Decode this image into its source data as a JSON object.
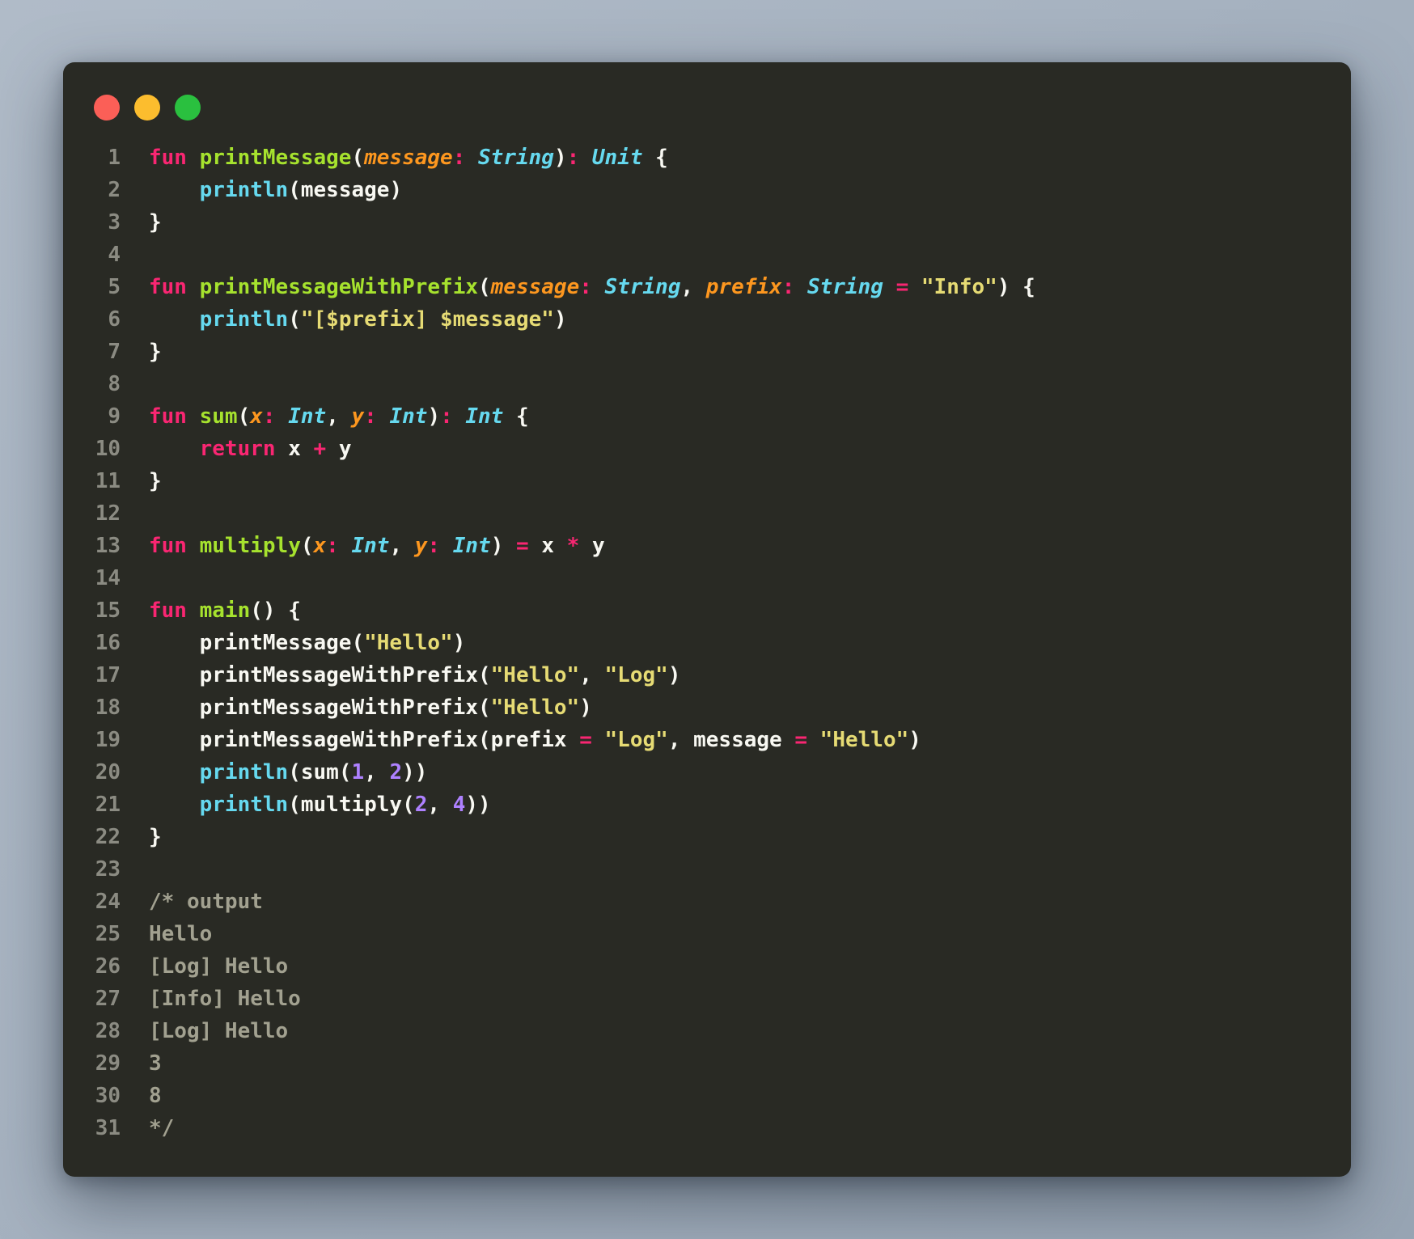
{
  "page": {
    "background_start": "#b0bbc8",
    "background_end": "#98a5b4"
  },
  "window": {
    "background": "#292a24",
    "title_bar": {
      "traffic_lights": [
        {
          "name": "close",
          "color": "#fb5f57"
        },
        {
          "name": "minimize",
          "color": "#fcbd2e"
        },
        {
          "name": "maximize",
          "color": "#2ac03f"
        }
      ]
    }
  },
  "editor": {
    "language": "kotlin",
    "gutter_color": "#8b8b82",
    "italic_token_types": [
      "param",
      "type"
    ],
    "token_colors": {
      "keyword": "#f92672",
      "function": "#a6e22e",
      "param": "#fd971f",
      "type": "#66d9ef",
      "builtin": "#66d9ef",
      "operator": "#f92672",
      "string": "#e6db74",
      "number": "#ae81ff",
      "plain": "#f8f8f2",
      "comment": "#a2a190"
    },
    "lines": [
      [
        [
          "fun",
          "keyword"
        ],
        [
          " ",
          "plain"
        ],
        [
          "printMessage",
          "function"
        ],
        [
          "(",
          "plain"
        ],
        [
          "message",
          "param"
        ],
        [
          ":",
          "operator"
        ],
        [
          " ",
          "plain"
        ],
        [
          "String",
          "type"
        ],
        [
          ")",
          "plain"
        ],
        [
          ":",
          "operator"
        ],
        [
          " ",
          "plain"
        ],
        [
          "Unit",
          "type"
        ],
        [
          " {",
          "plain"
        ]
      ],
      [
        [
          "    ",
          "plain"
        ],
        [
          "println",
          "builtin"
        ],
        [
          "(",
          "plain"
        ],
        [
          "message",
          "plain"
        ],
        [
          ")",
          "plain"
        ]
      ],
      [
        [
          "}",
          "plain"
        ]
      ],
      [],
      [
        [
          "fun",
          "keyword"
        ],
        [
          " ",
          "plain"
        ],
        [
          "printMessageWithPrefix",
          "function"
        ],
        [
          "(",
          "plain"
        ],
        [
          "message",
          "param"
        ],
        [
          ":",
          "operator"
        ],
        [
          " ",
          "plain"
        ],
        [
          "String",
          "type"
        ],
        [
          ", ",
          "plain"
        ],
        [
          "prefix",
          "param"
        ],
        [
          ":",
          "operator"
        ],
        [
          " ",
          "plain"
        ],
        [
          "String",
          "type"
        ],
        [
          " ",
          "plain"
        ],
        [
          "=",
          "operator"
        ],
        [
          " ",
          "plain"
        ],
        [
          "\"Info\"",
          "string"
        ],
        [
          ") {",
          "plain"
        ]
      ],
      [
        [
          "    ",
          "plain"
        ],
        [
          "println",
          "builtin"
        ],
        [
          "(",
          "plain"
        ],
        [
          "\"[$prefix] $message\"",
          "string"
        ],
        [
          ")",
          "plain"
        ]
      ],
      [
        [
          "}",
          "plain"
        ]
      ],
      [],
      [
        [
          "fun",
          "keyword"
        ],
        [
          " ",
          "plain"
        ],
        [
          "sum",
          "function"
        ],
        [
          "(",
          "plain"
        ],
        [
          "x",
          "param"
        ],
        [
          ":",
          "operator"
        ],
        [
          " ",
          "plain"
        ],
        [
          "Int",
          "type"
        ],
        [
          ", ",
          "plain"
        ],
        [
          "y",
          "param"
        ],
        [
          ":",
          "operator"
        ],
        [
          " ",
          "plain"
        ],
        [
          "Int",
          "type"
        ],
        [
          ")",
          "plain"
        ],
        [
          ":",
          "operator"
        ],
        [
          " ",
          "plain"
        ],
        [
          "Int",
          "type"
        ],
        [
          " {",
          "plain"
        ]
      ],
      [
        [
          "    ",
          "plain"
        ],
        [
          "return",
          "keyword"
        ],
        [
          " x ",
          "plain"
        ],
        [
          "+",
          "operator"
        ],
        [
          " y",
          "plain"
        ]
      ],
      [
        [
          "}",
          "plain"
        ]
      ],
      [],
      [
        [
          "fun",
          "keyword"
        ],
        [
          " ",
          "plain"
        ],
        [
          "multiply",
          "function"
        ],
        [
          "(",
          "plain"
        ],
        [
          "x",
          "param"
        ],
        [
          ":",
          "operator"
        ],
        [
          " ",
          "plain"
        ],
        [
          "Int",
          "type"
        ],
        [
          ", ",
          "plain"
        ],
        [
          "y",
          "param"
        ],
        [
          ":",
          "operator"
        ],
        [
          " ",
          "plain"
        ],
        [
          "Int",
          "type"
        ],
        [
          ") ",
          "plain"
        ],
        [
          "=",
          "operator"
        ],
        [
          " x ",
          "plain"
        ],
        [
          "*",
          "operator"
        ],
        [
          " y",
          "plain"
        ]
      ],
      [],
      [
        [
          "fun",
          "keyword"
        ],
        [
          " ",
          "plain"
        ],
        [
          "main",
          "function"
        ],
        [
          "() {",
          "plain"
        ]
      ],
      [
        [
          "    printMessage(",
          "plain"
        ],
        [
          "\"Hello\"",
          "string"
        ],
        [
          ")",
          "plain"
        ]
      ],
      [
        [
          "    printMessageWithPrefix(",
          "plain"
        ],
        [
          "\"Hello\"",
          "string"
        ],
        [
          ", ",
          "plain"
        ],
        [
          "\"Log\"",
          "string"
        ],
        [
          ")",
          "plain"
        ]
      ],
      [
        [
          "    printMessageWithPrefix(",
          "plain"
        ],
        [
          "\"Hello\"",
          "string"
        ],
        [
          ")",
          "plain"
        ]
      ],
      [
        [
          "    printMessageWithPrefix(prefix ",
          "plain"
        ],
        [
          "=",
          "operator"
        ],
        [
          " ",
          "plain"
        ],
        [
          "\"Log\"",
          "string"
        ],
        [
          ", message ",
          "plain"
        ],
        [
          "=",
          "operator"
        ],
        [
          " ",
          "plain"
        ],
        [
          "\"Hello\"",
          "string"
        ],
        [
          ")",
          "plain"
        ]
      ],
      [
        [
          "    ",
          "plain"
        ],
        [
          "println",
          "builtin"
        ],
        [
          "(sum(",
          "plain"
        ],
        [
          "1",
          "number"
        ],
        [
          ", ",
          "plain"
        ],
        [
          "2",
          "number"
        ],
        [
          "))",
          "plain"
        ]
      ],
      [
        [
          "    ",
          "plain"
        ],
        [
          "println",
          "builtin"
        ],
        [
          "(multiply(",
          "plain"
        ],
        [
          "2",
          "number"
        ],
        [
          ", ",
          "plain"
        ],
        [
          "4",
          "number"
        ],
        [
          "))",
          "plain"
        ]
      ],
      [
        [
          "}",
          "plain"
        ]
      ],
      [],
      [
        [
          "/* output",
          "comment"
        ]
      ],
      [
        [
          "Hello",
          "comment"
        ]
      ],
      [
        [
          "[Log] Hello",
          "comment"
        ]
      ],
      [
        [
          "[Info] Hello",
          "comment"
        ]
      ],
      [
        [
          "[Log] Hello",
          "comment"
        ]
      ],
      [
        [
          "3",
          "comment"
        ]
      ],
      [
        [
          "8",
          "comment"
        ]
      ],
      [
        [
          "*/",
          "comment"
        ]
      ]
    ]
  }
}
